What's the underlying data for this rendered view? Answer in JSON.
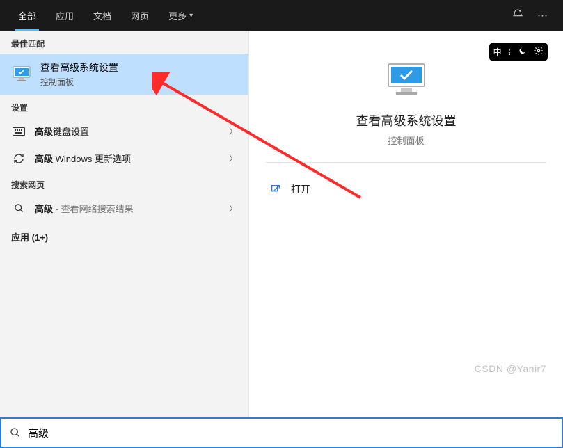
{
  "tabs": {
    "all": "全部",
    "apps": "应用",
    "docs": "文档",
    "web": "网页",
    "more": "更多"
  },
  "left": {
    "best_match_label": "最佳匹配",
    "best_match": {
      "title": "查看高级系统设置",
      "subtitle": "控制面板"
    },
    "settings_label": "设置",
    "setting_keyboard_bold": "高级",
    "setting_keyboard_rest": "键盘设置",
    "setting_update_bold": "高级",
    "setting_update_rest": " Windows 更新选项",
    "web_label": "搜索网页",
    "web_bold": "高级",
    "web_rest": " - 查看网络搜索结果",
    "apps_label": "应用 (1+)"
  },
  "right": {
    "title": "查看高级系统设置",
    "subtitle": "控制面板",
    "open_label": "打开",
    "ime": "中"
  },
  "search": {
    "value": "高级"
  },
  "watermark": "CSDN @Yanir7"
}
